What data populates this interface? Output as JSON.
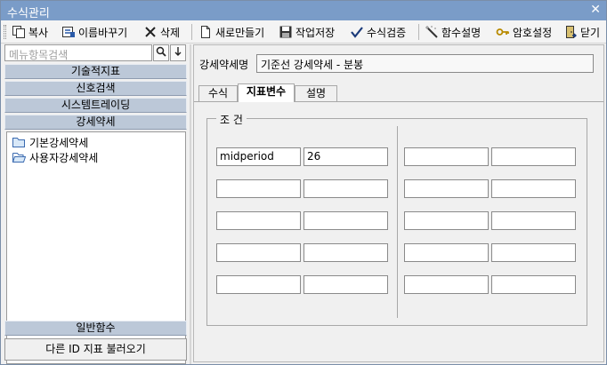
{
  "window": {
    "title": "수식관리",
    "close_label": "✕"
  },
  "toolbar": {
    "copy": "복사",
    "rename": "이름바꾸기",
    "delete": "삭제",
    "new": "새로만들기",
    "save": "작업저장",
    "verify": "수식검증",
    "func_help": "함수설명",
    "password": "암호설정",
    "close": "닫기"
  },
  "sidebar": {
    "search_placeholder": "메뉴항목검색",
    "categories": [
      "기술적지표",
      "신호검색",
      "시스템트레이딩",
      "강세약세"
    ],
    "tree_items": [
      "기본강세약세",
      "사용자강세약세"
    ],
    "bottom_category": "일반함수",
    "load_button": "다른 ID 지표 불러오기"
  },
  "main": {
    "name_label": "강세약세명",
    "name_value": "기준선 강세약세 - 분봉",
    "tabs": [
      "수식",
      "지표변수",
      "설명"
    ],
    "active_tab": 1,
    "group_title": "조 건",
    "conditions": [
      {
        "left_name": "midperiod",
        "left_value": "26",
        "right_name": "",
        "right_value": ""
      },
      {
        "left_name": "",
        "left_value": "",
        "right_name": "",
        "right_value": ""
      },
      {
        "left_name": "",
        "left_value": "",
        "right_name": "",
        "right_value": ""
      },
      {
        "left_name": "",
        "left_value": "",
        "right_name": "",
        "right_value": ""
      },
      {
        "left_name": "",
        "left_value": "",
        "right_name": "",
        "right_value": ""
      }
    ]
  }
}
